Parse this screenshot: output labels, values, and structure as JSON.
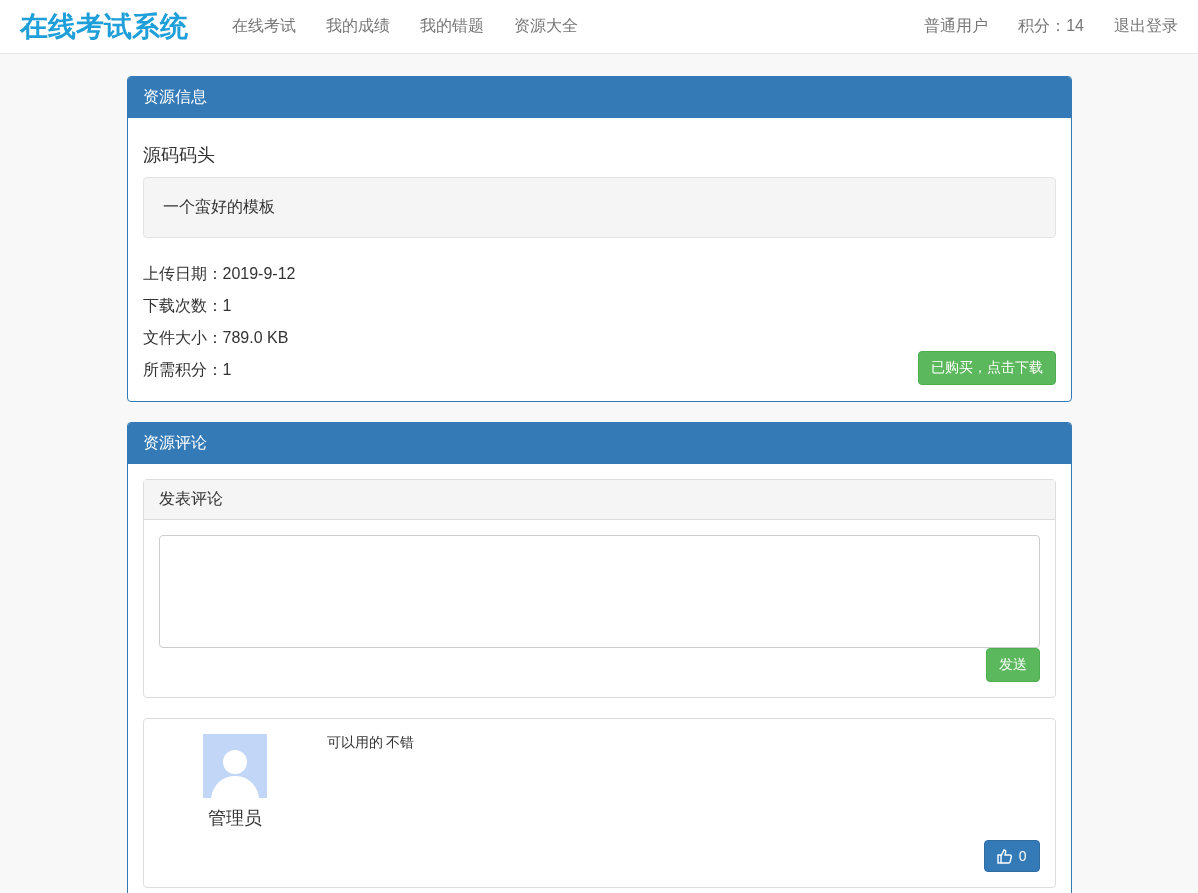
{
  "navbar": {
    "brand": "在线考试系统",
    "links": [
      "在线考试",
      "我的成绩",
      "我的错题",
      "资源大全"
    ],
    "user_links": [
      "普通用户",
      "积分：14",
      "退出登录"
    ]
  },
  "resource_info": {
    "heading": "资源信息",
    "name": "源码码头",
    "description": "一个蛮好的模板",
    "details": [
      "上传日期：2019-9-12",
      "下载次数：1",
      "文件大小：789.0 KB",
      "所需积分：1"
    ],
    "download_button": "已购买，点击下载"
  },
  "comments": {
    "heading": "资源评论",
    "form": {
      "heading": "发表评论",
      "submit_button": "发送"
    },
    "items": [
      {
        "author": "管理员",
        "text": "可以用的 不错",
        "likes": "0"
      }
    ]
  }
}
